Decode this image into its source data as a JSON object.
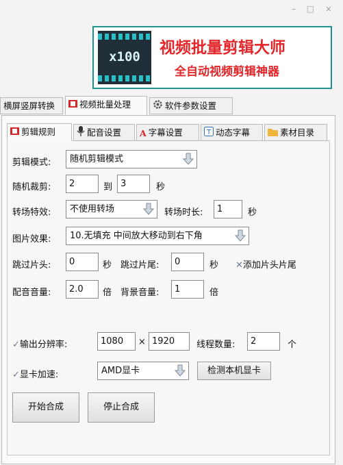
{
  "window_controls": "– □ ×",
  "banner": {
    "logo_text": "x100",
    "title": "视频批量剪辑大师",
    "subtitle": "全自动视频剪辑神器"
  },
  "main_tabs": [
    {
      "label": "横屏竖屏转换"
    },
    {
      "label": "视频批量处理"
    },
    {
      "label": "软件参数设置"
    }
  ],
  "sub_tabs": [
    {
      "label": "剪辑规则"
    },
    {
      "label": "配音设置"
    },
    {
      "label": "字幕设置"
    },
    {
      "label": "动态字幕"
    },
    {
      "label": "素材目录"
    }
  ],
  "form": {
    "edit_mode_label": "剪辑模式:",
    "edit_mode_value": "随机剪辑模式",
    "random_cut_label": "随机裁剪:",
    "random_cut_from": "2",
    "random_cut_to_label": "到",
    "random_cut_to": "3",
    "random_cut_unit": "秒",
    "transition_label": "转场特效:",
    "transition_value": "不使用转场",
    "transition_duration_label": "转场时长:",
    "transition_duration_value": "1",
    "transition_duration_unit": "秒",
    "image_effect_label": "图片效果:",
    "image_effect_value": "10.无填充 中间放大移动到右下角",
    "skip_head_label": "跳过片头:",
    "skip_head_value": "0",
    "skip_head_unit": "秒",
    "skip_tail_label": "跳过片尾:",
    "skip_tail_value": "0",
    "skip_tail_unit": "秒",
    "add_head_tail_label": "添加片头片尾",
    "dub_volume_label": "配音音量:",
    "dub_volume_value": "2.0",
    "dub_volume_unit": "倍",
    "bg_volume_label": "背景音量:",
    "bg_volume_value": "1",
    "bg_volume_unit": "倍",
    "resolution_label": "输出分辨率:",
    "resolution_w": "1080",
    "resolution_x": "×",
    "resolution_h": "1920",
    "threads_label": "线程数量:",
    "threads_value": "2",
    "threads_unit": "个",
    "gpu_label": "显卡加速:",
    "gpu_value": "AMD显卡",
    "detect_gpu_button": "检测本机显卡",
    "start_button": "开始合成",
    "stop_button": "停止合成"
  }
}
